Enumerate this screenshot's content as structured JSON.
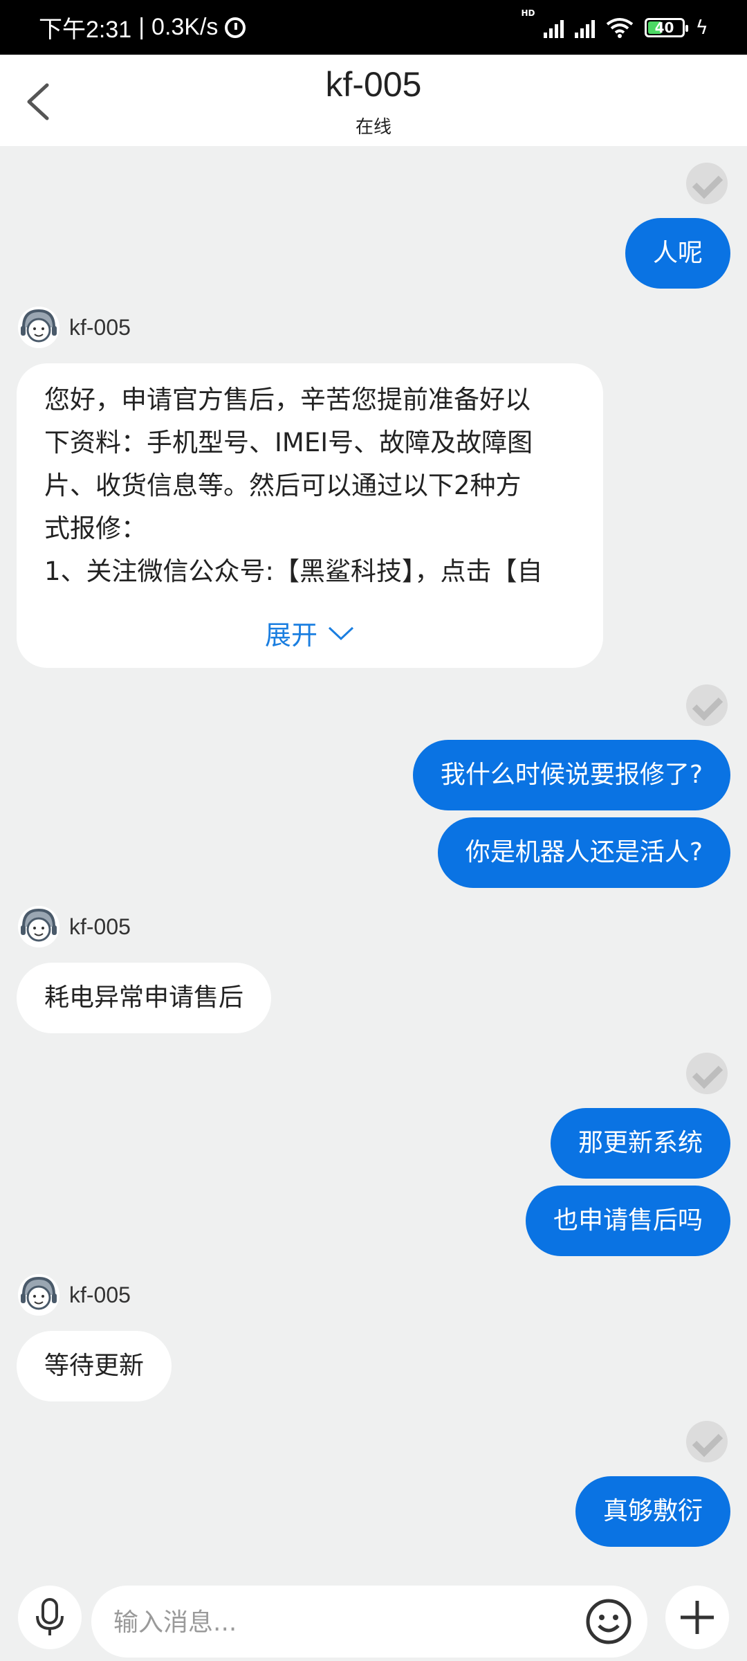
{
  "status_bar": {
    "time": "下午2:31",
    "separator": "|",
    "net_speed": "0.3K/s",
    "hd_label": "HD",
    "battery_level": "40",
    "icons": [
      "alarm-icon",
      "signal-icon",
      "wifi-icon",
      "battery-icon",
      "charging-icon"
    ]
  },
  "header": {
    "title": "kf-005",
    "subtitle": "在线",
    "back_icon": "chevron-left-icon"
  },
  "messages": {
    "out_1": "人呢",
    "agent_name_1": "kf-005",
    "long_reply_lines": [
      "您好，申请官方售后，辛苦您提前准备好以",
      "下资料：手机型号、IMEI号、故障及故障图",
      "片、收货信息等。然后可以通过以下2种方",
      "式报修：",
      "1、关注微信公众号:【黑鲨科技】，点击【自"
    ],
    "expand_label": "展开",
    "out_2": "我什么时候说要报修了?",
    "out_3": "你是机器人还是活人?",
    "agent_name_2": "kf-005",
    "in_2": "耗电异常申请售后",
    "out_4": "那更新系统",
    "out_5": "也申请售后吗",
    "agent_name_3": "kf-005",
    "in_3": "等待更新",
    "out_6": "真够敷衍"
  },
  "input_bar": {
    "placeholder": "输入消息...",
    "icons": [
      "microphone-icon",
      "emoji-icon",
      "plus-icon"
    ]
  },
  "colors": {
    "outgoing_bubble": "#0a73e3",
    "link": "#1a7ee0",
    "background": "#eff0f0"
  }
}
